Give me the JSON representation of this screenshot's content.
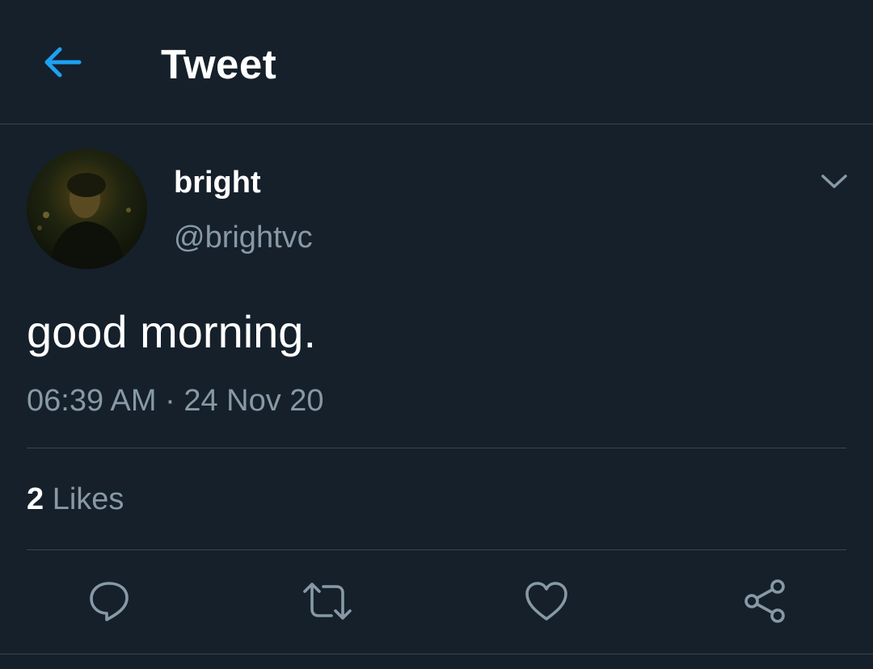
{
  "header": {
    "title": "Tweet",
    "back_icon": "arrow-left-icon"
  },
  "tweet": {
    "display_name": "bright",
    "handle": "@brightvc",
    "text": "good morning.",
    "timestamp": "06:39 AM · 24 Nov 20",
    "likes_count": "2",
    "likes_label": "Likes"
  },
  "actions": [
    {
      "name": "reply",
      "icon": "reply-icon"
    },
    {
      "name": "retweet",
      "icon": "retweet-icon"
    },
    {
      "name": "like",
      "icon": "heart-icon"
    },
    {
      "name": "share",
      "icon": "share-icon"
    }
  ],
  "colors": {
    "background": "#15202b",
    "accent": "#1da1f2",
    "secondary_text": "#8899a6",
    "divider": "#38444d"
  }
}
